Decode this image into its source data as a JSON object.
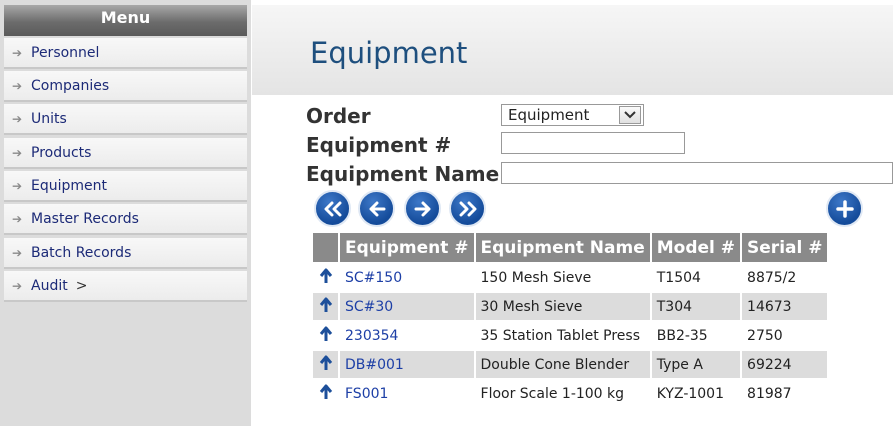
{
  "sidebar": {
    "header": "Menu",
    "items": [
      {
        "label": "Personnel",
        "extra": ""
      },
      {
        "label": "Companies",
        "extra": ""
      },
      {
        "label": "Units",
        "extra": ""
      },
      {
        "label": "Products",
        "extra": ""
      },
      {
        "label": "Equipment",
        "extra": ""
      },
      {
        "label": "Master Records",
        "extra": ""
      },
      {
        "label": "Batch Records",
        "extra": ""
      },
      {
        "label": "Audit",
        "extra": ">"
      }
    ]
  },
  "page": {
    "title": "Equipment"
  },
  "filters": {
    "order_label": "Order",
    "order_value": "Equipment",
    "equipment_number_label": "Equipment #",
    "equipment_number_value": "",
    "equipment_name_label": "Equipment Name",
    "equipment_name_value": ""
  },
  "table": {
    "columns": [
      "Equipment #",
      "Equipment Name",
      "Model #",
      "Serial #"
    ],
    "rows": [
      {
        "number": "SC#150",
        "name": "150 Mesh Sieve",
        "model": "T1504",
        "serial": "8875/2"
      },
      {
        "number": "SC#30",
        "name": "30 Mesh Sieve",
        "model": "T304",
        "serial": "14673"
      },
      {
        "number": "230354",
        "name": "35 Station Tablet Press",
        "model": "BB2-35",
        "serial": "2750"
      },
      {
        "number": "DB#001",
        "name": "Double Cone Blender",
        "model": "Type A",
        "serial": "69224"
      },
      {
        "number": "FS001",
        "name": "Floor Scale 1-100 kg",
        "model": "KYZ-1001",
        "serial": "81987"
      }
    ]
  },
  "colors": {
    "title": "#1e4f7e",
    "nav_button": "#144b9a",
    "link": "#1d3fa6",
    "header_bg": "#8a8a8a"
  }
}
